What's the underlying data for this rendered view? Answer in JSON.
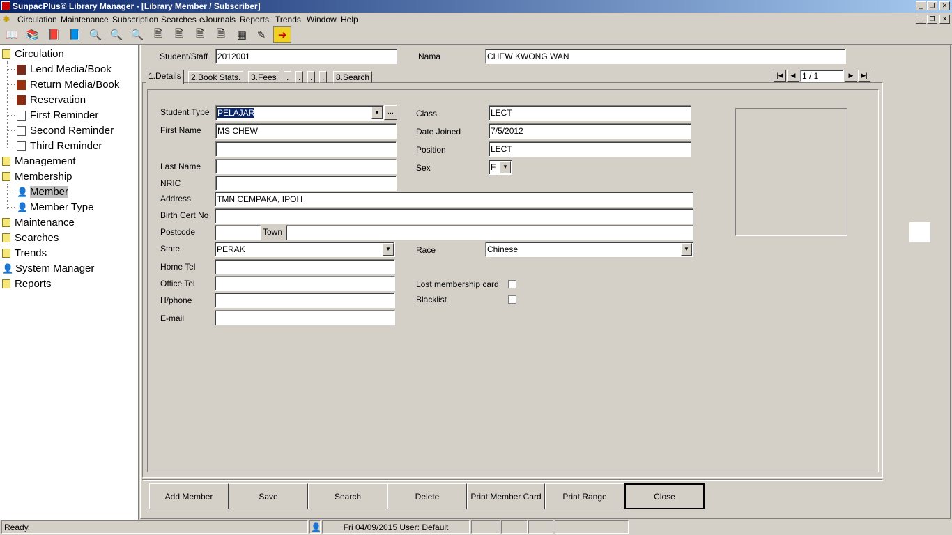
{
  "window": {
    "title": "SunpacPlus© Library Manager - [Library Member / Subscriber]"
  },
  "menu": [
    "Circulation",
    "Maintenance",
    "Subscription",
    "Searches",
    "eJournals",
    "Reports",
    "Trends",
    "Window",
    "Help"
  ],
  "tree": {
    "circulation": "Circulation",
    "lend": "Lend Media/Book",
    "return": "Return Media/Book",
    "reservation": "Reservation",
    "first_reminder": "First Reminder",
    "second_reminder": "Second Reminder",
    "third_reminder": "Third Reminder",
    "management": "Management",
    "membership": "Membership",
    "member": "Member",
    "member_type": "Member Type",
    "maintenance": "Maintenance",
    "searches": "Searches",
    "trends": "Trends",
    "system_manager": "System Manager",
    "reports": "Reports"
  },
  "header": {
    "student_staff_label": "Student/Staff",
    "student_staff_value": "2012001",
    "nama_label": "Nama",
    "nama_value": "CHEW KWONG WAN"
  },
  "tabs": [
    "1.Details",
    "2.Book Stats.",
    "3.Fees",
    ".",
    ".",
    ".",
    ".",
    "8.Search"
  ],
  "record_nav": {
    "position": "1 / 1"
  },
  "form": {
    "student_type_label": "Student Type",
    "student_type_value": "PELAJAR",
    "ellipsis": "...",
    "first_name_label": "First Name",
    "first_name_value": "MS CHEW",
    "first_name_2_value": "",
    "last_name_label": "Last Name",
    "last_name_value": "",
    "nric_label": "NRIC",
    "nric_value": "",
    "address_label": "Address",
    "address_value": "TMN CEMPAKA, IPOH",
    "birth_cert_label": "Birth Cert No",
    "birth_cert_value": "",
    "postcode_label": "Postcode",
    "postcode_value": "",
    "town_label": "Town",
    "town_value": "",
    "state_label": "State",
    "state_value": "PERAK",
    "home_tel_label": "Home Tel",
    "home_tel_value": "",
    "office_tel_label": "Office Tel",
    "office_tel_value": "",
    "hphone_label": "H/phone",
    "hphone_value": "",
    "email_label": "E-mail",
    "email_value": "",
    "class_label": "Class",
    "class_value": "LECT",
    "date_joined_label": "Date Joined",
    "date_joined_value": "7/5/2012",
    "position_label": "Position",
    "position_value": "LECT",
    "sex_label": "Sex",
    "sex_value": "F",
    "race_label": "Race",
    "race_value": "Chinese",
    "lost_card_label": "Lost membership card",
    "lost_card_checked": false,
    "blacklist_label": "Blacklist",
    "blacklist_checked": false
  },
  "buttons": {
    "add_member": "Add Member",
    "save": "Save",
    "search": "Search",
    "delete": "Delete",
    "print_member_card": "Print Member Card",
    "print_range": "Print Range",
    "close": "Close"
  },
  "status": {
    "ready": "Ready.",
    "datetime_user": "Fri 04/09/2015 User: Default"
  },
  "colors": {
    "titlebar_start": "#0a246a",
    "titlebar_end": "#a6caf0",
    "face": "#d4d0c8",
    "selection": "#0a246a"
  }
}
